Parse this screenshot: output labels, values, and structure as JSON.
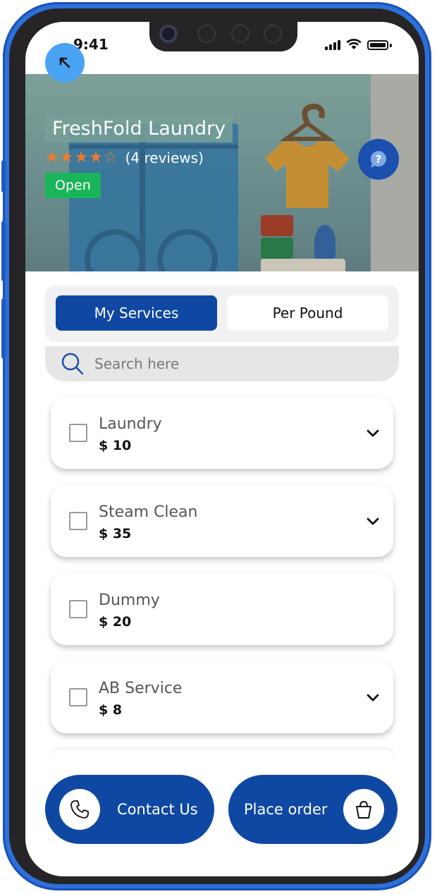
{
  "status": {
    "time": "9:41"
  },
  "hero": {
    "title": "FreshFold Laundry",
    "stars": "★★★★☆",
    "reviews": "(4 reviews)",
    "status_badge": "Open"
  },
  "tabs": [
    {
      "label": "My Services"
    },
    {
      "label": "Per Pound"
    }
  ],
  "search": {
    "placeholder": "Search here"
  },
  "services": [
    {
      "name": "Laundry",
      "price": "$ 10",
      "expandable": true
    },
    {
      "name": "Steam Clean",
      "price": "$ 35",
      "expandable": true
    },
    {
      "name": "Dummy",
      "price": "$ 20",
      "expandable": false
    },
    {
      "name": "AB Service",
      "price": "$ 8",
      "expandable": true
    }
  ],
  "actions": {
    "contact_label": "Contact Us",
    "order_label": "Place order"
  },
  "colors": {
    "primary": "#0f48a3",
    "accent_blue": "#4aa3f2",
    "open_green": "#1ab55a",
    "star_orange": "#f07a2a",
    "frame_blue": "#2c70d8"
  },
  "icons": [
    "back-arrow-icon",
    "help-chat-icon",
    "search-icon",
    "chevron-down-icon",
    "phone-icon",
    "shopping-bag-icon"
  ]
}
